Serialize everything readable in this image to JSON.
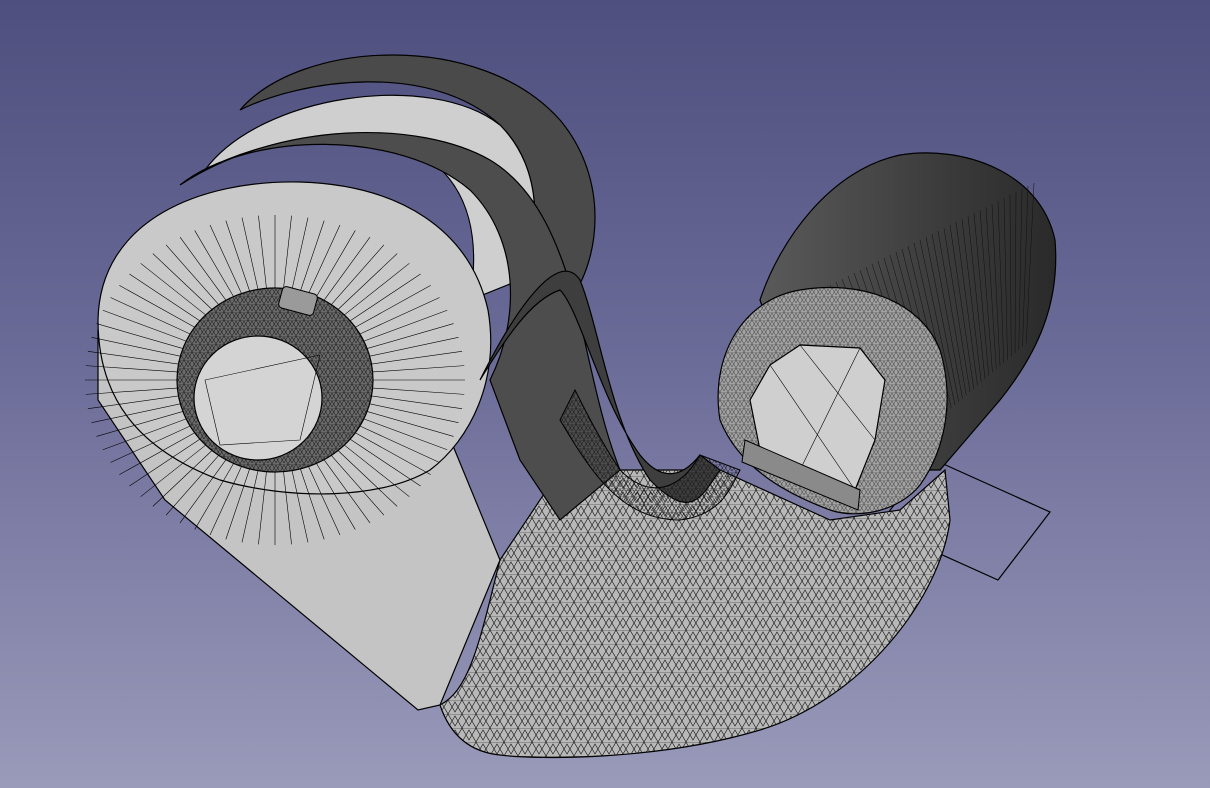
{
  "app": {
    "view": "3d-viewport",
    "draw_style": "flat-lines"
  },
  "scene": {
    "model": "mesh-part",
    "colors": {
      "background_top": "#4f4f7f",
      "background_bottom": "#9a9aba",
      "face_light": "#c8c8c8",
      "face_mid": "#a9a9a9",
      "face_dark": "#4a4a4a",
      "edge": "#000000"
    }
  }
}
